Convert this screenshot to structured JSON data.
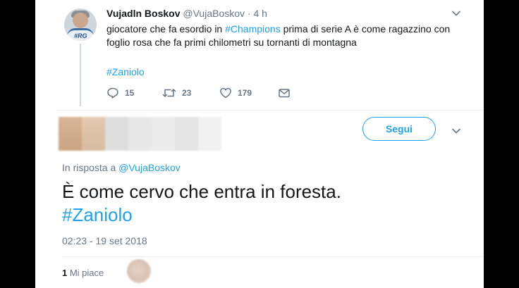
{
  "tweet": {
    "author_name": "Vujadln Boskov",
    "author_handle": "@VujaBoskov",
    "separator": "·",
    "time": "4 h",
    "avatar_tag": "#RG",
    "text_part1": "giocatore che fa esordio in ",
    "text_hashtag1": "#Champions",
    "text_part2": " prima di serie A è come ragazzino con foglio rosa che fa primi chilometri su tornanti di montagna",
    "hashtag": "#Zaniolo",
    "replies": "15",
    "retweets": "23",
    "likes": "179"
  },
  "reply": {
    "follow_label": "Segui",
    "in_reply_prefix": "In risposta a ",
    "in_reply_handle": "@VujaBoskov",
    "text": "È come cervo che entra in foresta.",
    "hashtag": "#Zaniolo",
    "timestamp": "02:23 - 19 set 2018",
    "likes_count": "1",
    "likes_label": " Mi piace"
  },
  "colors": {
    "accent": "#1da1f2",
    "text": "#14171a",
    "secondary": "#657786",
    "divider": "#e6ecf0"
  },
  "icons": [
    "reply-icon",
    "retweet-icon",
    "like-icon",
    "direct-message-icon",
    "chevron-down-icon"
  ]
}
